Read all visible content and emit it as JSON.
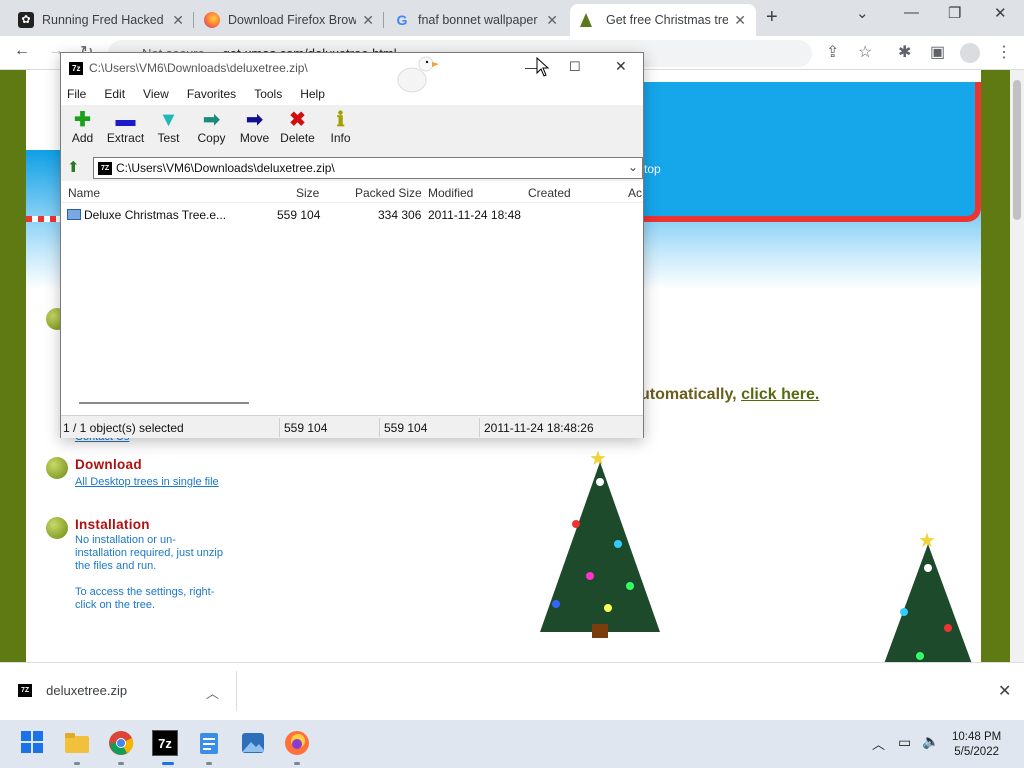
{
  "browser": {
    "tabs": [
      {
        "title": "Running Fred Hacked (",
        "icon": "fred-icon"
      },
      {
        "title": "Download Firefox Brow",
        "icon": "firefox-icon"
      },
      {
        "title": "fnaf bonnet wallpaper",
        "icon": "google-icon"
      },
      {
        "title": "Get free Christmas tree",
        "icon": "tree-icon",
        "active": true
      }
    ],
    "security": "Not secure",
    "url": "get-xmas.com/deluxetree.html"
  },
  "page": {
    "top_text": "top",
    "auto_text": "utomatically, ",
    "auto_link": "click here.",
    "contact": "Contact Us",
    "sections": [
      {
        "heading": "Download",
        "link": "All Desktop trees in single file"
      },
      {
        "heading": "Installation",
        "text1": "No installation or un-installation required, just unzip the files and run.",
        "text2": "To access the settings, right-click on the tree."
      }
    ]
  },
  "zip": {
    "icon_label": "7z",
    "title": "C:\\Users\\VM6\\Downloads\\deluxetree.zip\\",
    "menu": [
      "File",
      "Edit",
      "View",
      "Favorites",
      "Tools",
      "Help"
    ],
    "tools": [
      {
        "label": "Add",
        "glyph": "✚",
        "color": "#1aa01a"
      },
      {
        "label": "Extract",
        "glyph": "▬",
        "color": "#1a1ac8"
      },
      {
        "label": "Test",
        "glyph": "▼",
        "color": "#20b8b8"
      },
      {
        "label": "Copy",
        "glyph": "➡",
        "color": "#1a8a7a"
      },
      {
        "label": "Move",
        "glyph": "➡",
        "color": "#101090"
      },
      {
        "label": "Delete",
        "glyph": "✖",
        "color": "#d01010"
      },
      {
        "label": "Info",
        "glyph": "ℹ",
        "color": "#a0a000"
      }
    ],
    "address": "C:\\Users\\VM6\\Downloads\\deluxetree.zip\\",
    "columns": [
      "Name",
      "Size",
      "Packed Size",
      "Modified",
      "Created",
      "Ac"
    ],
    "rows": [
      {
        "name": "Deluxe Christmas Tree.e...",
        "size": "559 104",
        "packed": "334 306",
        "modified": "2011-11-24 18:48"
      }
    ],
    "status": {
      "selected": "1 / 1 object(s) selected",
      "size": "559 104",
      "packed": "559 104",
      "modified": "2011-11-24 18:48:26"
    }
  },
  "download": {
    "file": "deluxetree.zip"
  },
  "taskbar": {
    "time": "10:48 PM",
    "date": "5/5/2022"
  }
}
